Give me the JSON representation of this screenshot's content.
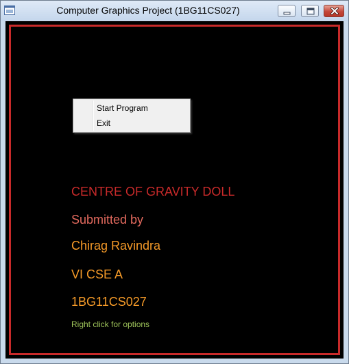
{
  "window": {
    "title": "Computer Graphics Project (1BG11CS027)"
  },
  "context_menu": {
    "items": [
      {
        "label": "Start Program"
      },
      {
        "label": "Exit"
      }
    ]
  },
  "content": {
    "title": "CENTRE OF GRAVITY DOLL",
    "submitted_by": "Submitted by",
    "name": "Chirag Ravindra",
    "class": "VI CSE A",
    "usn": "1BG11CS027",
    "hint": "Right click for options"
  },
  "colors": {
    "background": "#000000",
    "border": "#c82a2a",
    "title": "#c82a2a",
    "submitted_by": "#e36a5e",
    "name": "#f59a28",
    "class": "#f59a28",
    "usn": "#f59a28",
    "hint": "#9ec35a"
  },
  "icons": {
    "app": "app-window-icon",
    "minimize": "minimize-icon",
    "maximize": "maximize-icon",
    "close": "close-icon"
  }
}
